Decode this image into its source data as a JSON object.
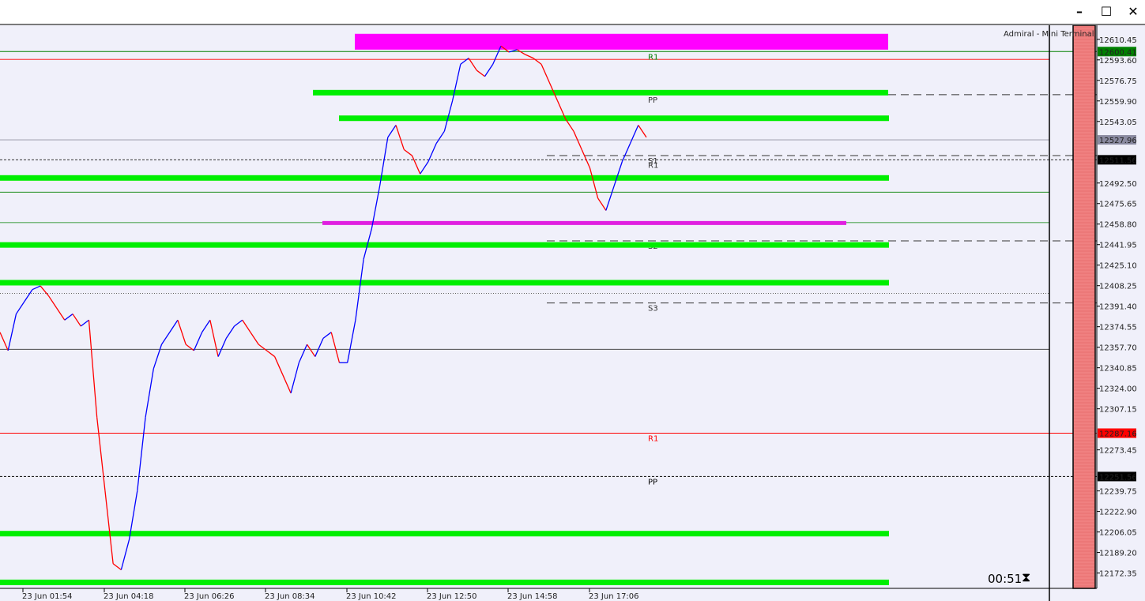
{
  "window": {
    "minimize_glyph": "–",
    "maximize_glyph": "☐",
    "close_glyph": "✕"
  },
  "terminal_label": "Admiral - Mini Terminal",
  "timer": {
    "text": "00:51",
    "icon": "hourglass-icon"
  },
  "colors": {
    "background": "#f0f0fa",
    "zone_green": "#00ee00",
    "zone_magenta": "#ff00ff",
    "up_candle": "#0000ff",
    "down_candle": "#ff0000",
    "resistance_line": "#ff0000",
    "support_line": "#008000",
    "right_panel": "#f08080"
  },
  "chart_data": {
    "type": "line",
    "x_tick_labels": [
      "23 Jun 01:54",
      "23 Jun 04:18",
      "23 Jun 06:26",
      "23 Jun 08:34",
      "23 Jun 10:42",
      "23 Jun 12:50",
      "23 Jun 14:58",
      "23 Jun 17:06"
    ],
    "y_tick_labels": [
      "12610.45",
      "12593.60",
      "12576.75",
      "12559.90",
      "12543.05",
      "12492.50",
      "12475.65",
      "12458.80",
      "12441.95",
      "12425.10",
      "12408.25",
      "12391.40",
      "12374.55",
      "12357.70",
      "12340.85",
      "12324.00",
      "12307.15",
      "12273.45",
      "12239.75",
      "12222.90",
      "12206.05",
      "12189.20",
      "12172.35"
    ],
    "ylim": [
      12163,
      12622
    ],
    "price_tags": [
      {
        "value": 12600.41,
        "text": "12600.41",
        "bg": "#008000",
        "fg": "#ffffff"
      },
      {
        "value": 12527.96,
        "text": "12527.96",
        "bg": "#8a8aa0",
        "fg": "#ffffff"
      },
      {
        "value": 12511.56,
        "text": "12511.56",
        "bg": "#000000",
        "fg": "#ffffff"
      },
      {
        "value": 12287.16,
        "text": "12287.16",
        "bg": "#ff0000",
        "fg": "#ffffff"
      },
      {
        "value": 12251.56,
        "text": "12251.56",
        "bg": "#000000",
        "fg": "#ffffff"
      }
    ],
    "zones": [
      {
        "kind": "magenta",
        "y_top": 12615,
        "y_bottom": 12602,
        "x_from": "23 Jun 10:42",
        "x_to": "end"
      },
      {
        "kind": "green",
        "y": 12567,
        "x_from": "23 Jun 08:34",
        "x_to": "end"
      },
      {
        "kind": "green",
        "y": 12546,
        "x_from": "23 Jun 10:42",
        "x_to": "end"
      },
      {
        "kind": "green",
        "y": 12497,
        "x_from": "start",
        "x_to": "end"
      },
      {
        "kind": "magenta_line",
        "y": 12460,
        "x_from": "23 Jun 08:34",
        "x_to": "23 Jun 17:06"
      },
      {
        "kind": "green",
        "y": 12442,
        "x_from": "start",
        "x_to": "end"
      },
      {
        "kind": "green",
        "y": 12411,
        "x_from": "start",
        "x_to": "end"
      },
      {
        "kind": "green",
        "y": 12205,
        "x_from": "start",
        "x_to": "end"
      },
      {
        "kind": "green",
        "y": 12165,
        "x_from": "start",
        "x_to": "end"
      }
    ],
    "pivot_levels": [
      {
        "label": "R1",
        "value": 12600.41,
        "color": "#008000",
        "style": "solid"
      },
      {
        "label": "PP",
        "value": 12565,
        "color": "#333333",
        "style": "dashed"
      },
      {
        "label": "S1",
        "value": 12515,
        "color": "#333333",
        "style": "dashed"
      },
      {
        "label": "R1",
        "value": 12511.56,
        "color": "#333333",
        "style": "dotted"
      },
      {
        "label": "S2",
        "value": 12445,
        "color": "#333333",
        "style": "dashed"
      },
      {
        "label": "S3",
        "value": 12394,
        "color": "#333333",
        "style": "dashed"
      },
      {
        "label": "R1",
        "value": 12287.16,
        "color": "#ff0000",
        "style": "solid"
      },
      {
        "label": "PP",
        "value": 12251.56,
        "color": "#000000",
        "style": "dotted"
      }
    ],
    "horizontal_lines": [
      {
        "value": 12594,
        "color": "#ff0000"
      },
      {
        "value": 12527.96,
        "color": "#9090a0"
      },
      {
        "value": 12485,
        "color": "#008000"
      },
      {
        "value": 12460,
        "color": "#008000"
      },
      {
        "value": 12356,
        "color": "#333333"
      },
      {
        "value": 12402,
        "color": "#333333",
        "style": "dotted"
      }
    ],
    "series": [
      {
        "values": [
          12370,
          12355,
          12385,
          12395,
          12405,
          12408,
          12400,
          12390,
          12380,
          12385,
          12375,
          12380,
          12300,
          12240,
          12180,
          12175,
          12200,
          12240,
          12300,
          12340,
          12360,
          12370,
          12380,
          12360,
          12355,
          12370,
          12380,
          12350,
          12365,
          12375,
          12380,
          12370,
          12360,
          12355,
          12350,
          12335,
          12320,
          12345,
          12360,
          12350,
          12365,
          12370,
          12345,
          12345,
          12380,
          12430,
          12455,
          12490,
          12530,
          12540,
          12520,
          12515,
          12500,
          12510,
          12525,
          12535,
          12560,
          12590,
          12595,
          12585,
          12580,
          12590,
          12605,
          12600,
          12602,
          12598,
          12595,
          12590,
          12575,
          12560,
          12545,
          12535,
          12520,
          12505,
          12480,
          12470,
          12490,
          12510,
          12525,
          12540,
          12530
        ]
      }
    ]
  }
}
